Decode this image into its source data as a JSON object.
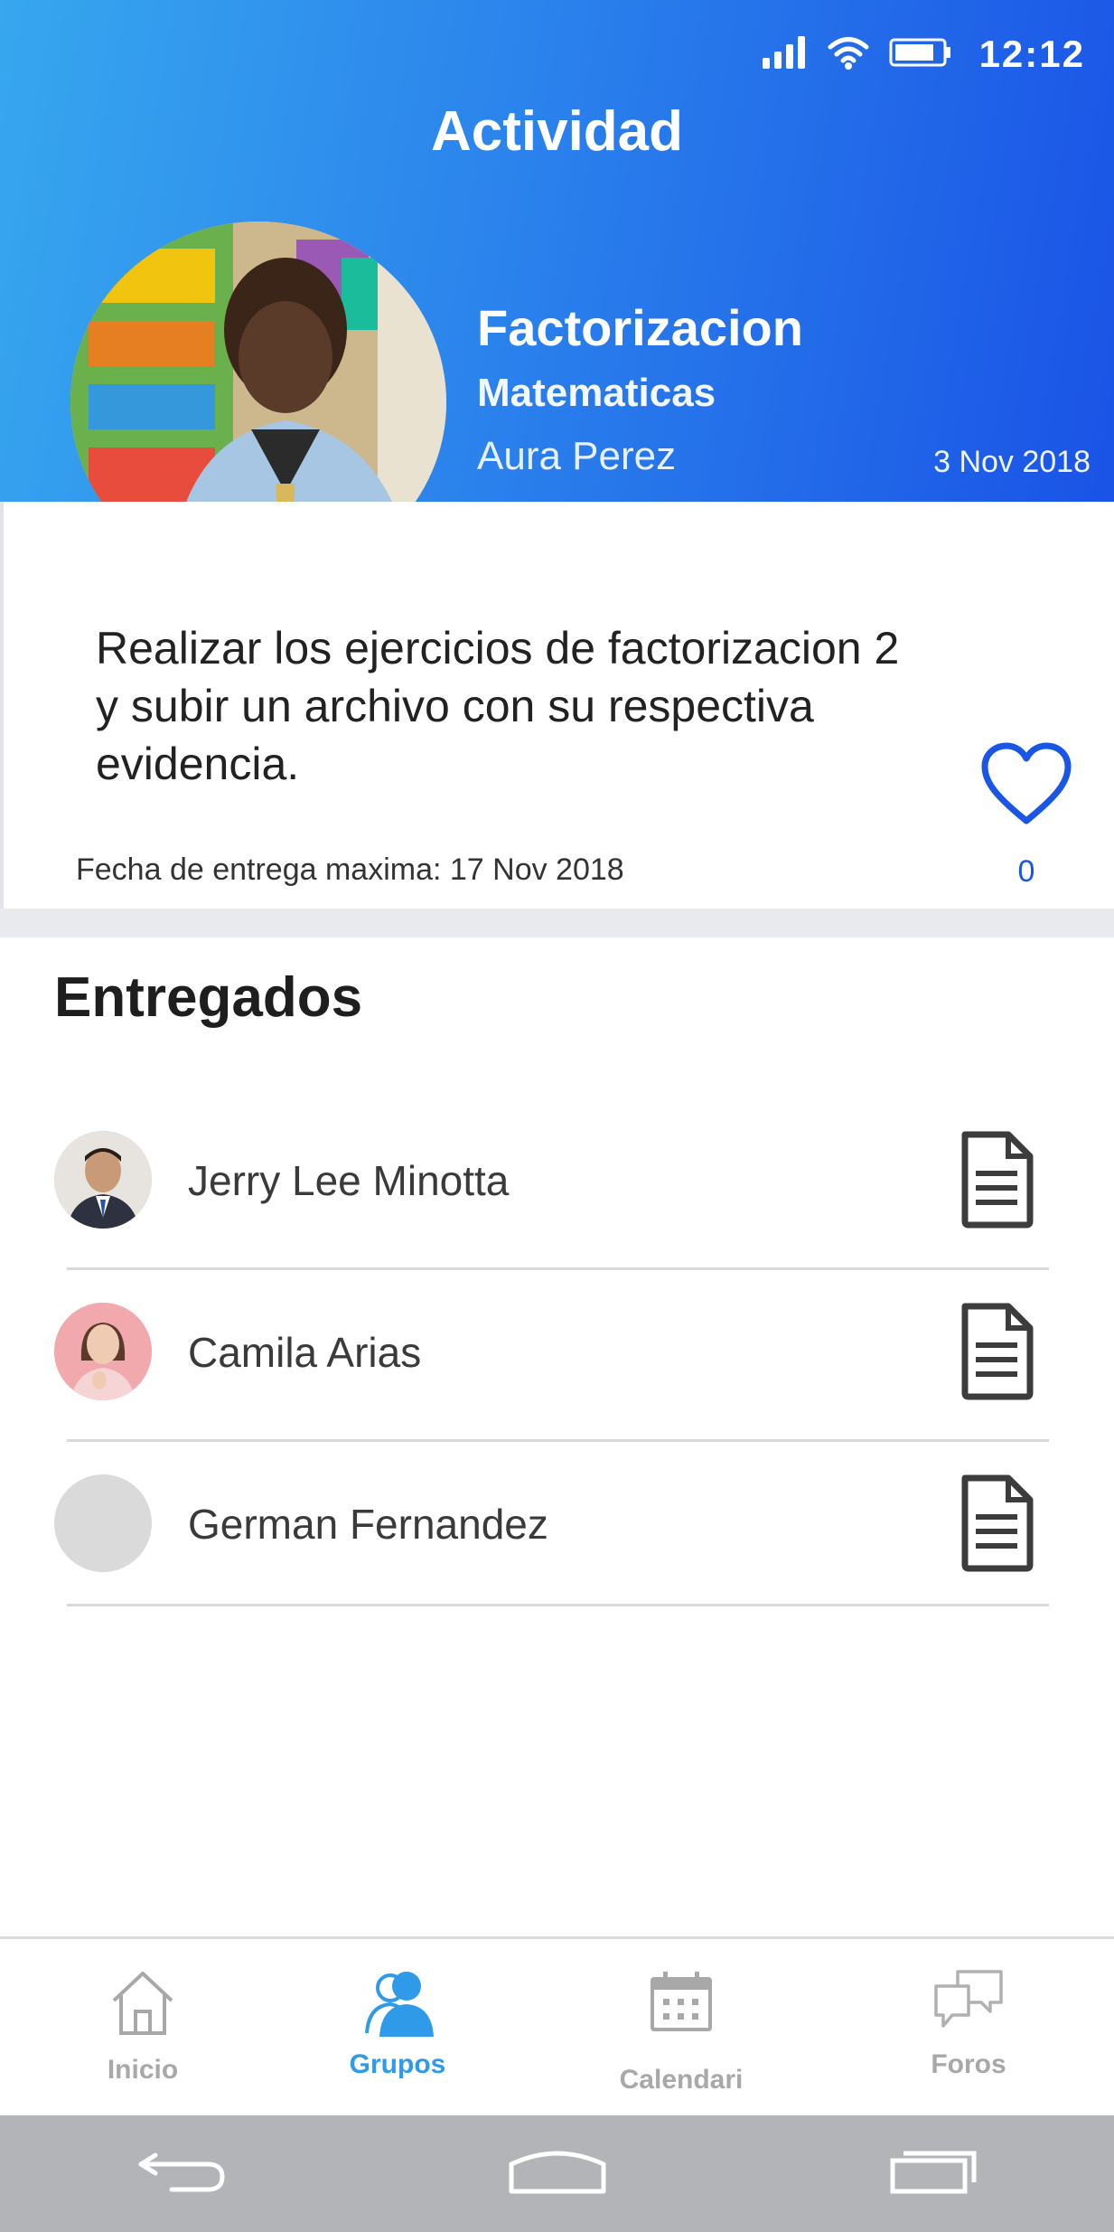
{
  "status_bar": {
    "time": "12:12"
  },
  "header": {
    "title": "Actividad",
    "activity_name": "Factorizacion",
    "subject": "Matematicas",
    "teacher": "Aura Perez",
    "date": "3 Nov 2018"
  },
  "card": {
    "description": "Realizar los ejercicios de factorizacion 2 y subir un archivo con su respectiva evidencia.",
    "deadline": "Fecha de entrega maxima: 17 Nov 2018",
    "likes": "0"
  },
  "delivered": {
    "title": "Entregados",
    "items": [
      {
        "name": "Jerry Lee Minotta"
      },
      {
        "name": "Camila Arias"
      },
      {
        "name": "German Fernandez"
      }
    ]
  },
  "bottom_nav": {
    "items": [
      {
        "label": "Inicio",
        "icon": "home-icon"
      },
      {
        "label": "Grupos",
        "icon": "group-icon",
        "active": true
      },
      {
        "label": "Calendari\no",
        "icon": "calendar-icon"
      },
      {
        "label": "Foros",
        "icon": "chat-bubbles-icon"
      }
    ]
  },
  "colors": {
    "header_start": "#37a7ee",
    "header_end": "#1a53e6",
    "accent": "#2f9be8",
    "like": "#1a56e6"
  }
}
